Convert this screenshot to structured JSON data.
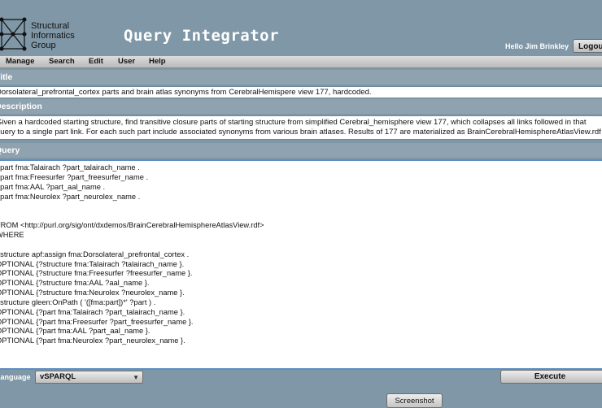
{
  "header": {
    "logo_lines": [
      "Structural",
      "Informatics",
      "Group"
    ],
    "app_title": "Query Integrator",
    "greeting": "Hello Jim Brinkley",
    "logout_label": "Logout"
  },
  "menu": [
    "Manage",
    "Search",
    "Edit",
    "User",
    "Help"
  ],
  "title_section": {
    "heading": "Title",
    "value": "Dorsolateral_prefrontal_cortex parts and brain atlas synonyms from CerebralHemispere view 177, hardcoded."
  },
  "description_section": {
    "heading": "Description",
    "lines": [
      "Given a hardcoded starting structure, find transitive closure parts of starting structure from simplified Cerebral_hemisphere view 177, which  collapses all links followed in that",
      "query to a single part link. For each such part include associated synonyms from various brain atlases. Results of 177 are materialized as BrainCerebralHemisphereAtlasView.rdf"
    ]
  },
  "query_section": {
    "heading": "Query",
    "lines": [
      "?part fma:Talairach ?part_talairach_name .",
      "?part fma:Freesurfer ?part_freesurfer_name .",
      "?part fma:AAL ?part_aal_name .",
      "?part fma:Neurolex ?part_neurolex_name .",
      "",
      "",
      "FROM <http://purl.org/sig/ont/dxdemos/BrainCerebralHemisphereAtlasView.rdf>",
      "WHERE",
      "",
      "?structure apf:assign fma:Dorsolateral_prefrontal_cortex  .",
      "OPTIONAL {?structure fma:Talairach ?talairach_name }.",
      "OPTIONAL {?structure fma:Freesurfer ?freesurfer_name }.",
      "OPTIONAL {?structure fma:AAL ?aal_name }.",
      "OPTIONAL {?structure fma:Neurolex ?neurolex_name }.",
      "?structure gleen:OnPath ( '([fma:part])*' ?part )  .",
      "OPTIONAL {?part fma:Talairach ?part_talairach_name }.",
      "OPTIONAL {?part fma:Freesurfer ?part_freesurfer_name }.",
      "OPTIONAL {?part fma:AAL ?part_aal_name }.",
      "OPTIONAL {?part fma:Neurolex ?part_neurolex_name }."
    ]
  },
  "footer": {
    "language_label": "Language",
    "language_value": "vSPARQL",
    "execute_label": "Execute",
    "screenshot_label": "Screenshot"
  }
}
